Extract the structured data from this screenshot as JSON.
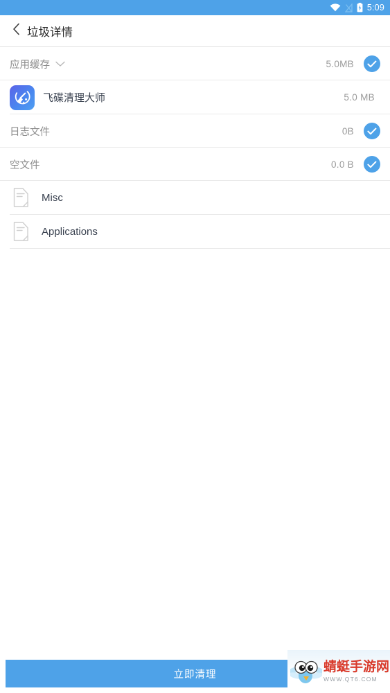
{
  "theme": {
    "accent": "#4ea2e8",
    "status_bar_bg": "#4ea2e8",
    "divider": "#e9e9e9",
    "label_gray": "#8c8c8c",
    "label_dark": "#3a4250",
    "watermark_red": "#d93a2b"
  },
  "status_bar": {
    "time": "5:09",
    "icons": [
      "wifi-icon",
      "signal-off-icon",
      "battery-charging-icon"
    ]
  },
  "app_bar": {
    "back_icon": "chevron-left-icon",
    "title": "垃圾详情"
  },
  "list": {
    "rows": [
      {
        "name": "app-cache",
        "label": "应用缓存",
        "size": "5.0MB",
        "type": "category",
        "has_chevron": true,
        "checked": true,
        "icon": null
      },
      {
        "name": "feidie-cleaner",
        "label": "飞碟清理大师",
        "size": "5.0 MB",
        "type": "child-app",
        "has_chevron": false,
        "checked": false,
        "icon": "broom-app-icon"
      },
      {
        "name": "log-files",
        "label": "日志文件",
        "size": "0B",
        "type": "category",
        "has_chevron": false,
        "checked": true,
        "icon": null
      },
      {
        "name": "empty-files",
        "label": "空文件",
        "size": "0.0 B",
        "type": "category",
        "has_chevron": false,
        "checked": true,
        "icon": null
      },
      {
        "name": "misc",
        "label": "Misc",
        "size": "",
        "type": "child-doc",
        "has_chevron": false,
        "checked": false,
        "icon": "document-icon"
      },
      {
        "name": "applications",
        "label": "Applications",
        "size": "",
        "type": "child-doc",
        "has_chevron": false,
        "checked": false,
        "icon": "document-icon"
      }
    ]
  },
  "bottom": {
    "clean_button_label": "立即清理"
  },
  "watermark": {
    "title": "蜻蜓手游网",
    "subtitle": "WWW.QT6.COM",
    "mascot": "dragonfly-icon"
  }
}
